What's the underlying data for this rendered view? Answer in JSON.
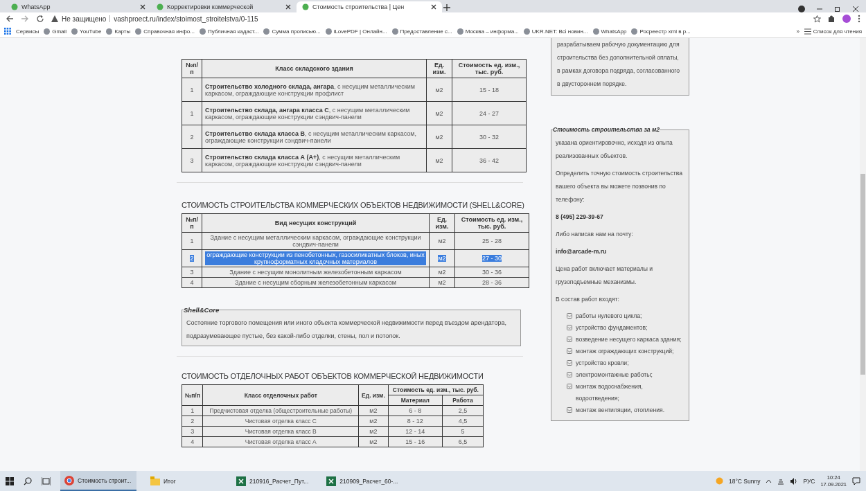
{
  "browser": {
    "tabs": [
      {
        "title": "WhatsApp",
        "selected": false
      },
      {
        "title": "Корректировки коммерческой",
        "selected": false
      },
      {
        "title": "Стоимость строительства | Цен",
        "selected": true
      }
    ],
    "security": "Не защищено",
    "url": "vashproect.ru/index/stoimost_stroitelstva/0-115",
    "bookmarks": [
      "Сервисы",
      "Gmail",
      "YouTube",
      "Карты",
      "Справочная инфо...",
      "Публичная кадаст...",
      "Сумма прописью...",
      "iLovePDF | Онлайн...",
      "Предоставление с...",
      "Москва – информа...",
      "UKR.NET: Всі новин...",
      "WhatsApp",
      "Росреестр xml в р..."
    ],
    "more": "»",
    "reading_list": "Список для чтения"
  },
  "warehouse_table": {
    "columns": [
      "№п/ п",
      "Класс складского здания",
      "Ед. изм.",
      "Стоимость ед. изм., тыс. руб."
    ],
    "rows": [
      [
        "1",
        "**Строительство холодного склада, ангара**, с несущим металлическим каркасом, ограждающие конструкции профлист",
        "м2",
        "15 - 18"
      ],
      [
        "1",
        "**Строительство склада, ангара класса С**, с несущим металлическим каркасом, ограждающие конструкции сэндвич-панели",
        "м2",
        "24 - 27"
      ],
      [
        "2",
        "**Строительство склада класса В**, с несущим металлическим каркасом, ограждающие конструкции сэндвич-панели",
        "м2",
        "30 - 32"
      ],
      [
        "3",
        "**Строительство склада класса А (А+)**, с несущим металлическим каркасом, ограждающие конструкции сэндвич-панели",
        "м2",
        "36 - 42"
      ]
    ]
  },
  "commercial_section": {
    "heading": "СТОИМОСТЬ СТРОИТЕЛЬСТВА КОММЕРЧЕСКИХ ОБЪЕКТОВ НЕДВИЖИМОСТИ (SHELL&CORE)",
    "columns": [
      "№п/ п",
      "Вид несущих конструкций",
      "Ед. изм.",
      "Стоимость ед. изм., тыс. руб."
    ],
    "rows": [
      {
        "cells": [
          "1",
          "Здание с несущим металлическим каркасом, ограждающие конструкции сэндвич-панели",
          "м2",
          "25 - 28"
        ],
        "text_selected": false
      },
      {
        "cells": [
          "2",
          "ограждающие конструкции из пенобетонных, газосиликатных блоков, иных крупноформатных кладочных материалов",
          "м2",
          "27 - 30"
        ],
        "text_selected": true
      },
      {
        "cells": [
          "3",
          "Здание с несущим монолитным железобетонным каркасом",
          "м2",
          "30 - 36"
        ],
        "text_selected": false
      },
      {
        "cells": [
          "4",
          "Здание с несущим сборным железобетонным каркасом",
          "м2",
          "28 - 36"
        ],
        "text_selected": false
      }
    ],
    "note": {
      "title": "Shell&Core",
      "text": "Состояние торгового помещения или иного объекта коммерческой недвижимости перед въездом арендатора, подразумевающее пустые, без какой-либо отделки, стены, пол и потолок."
    }
  },
  "finishing_section": {
    "heading": "СТОИМОСТЬ ОТДЕЛОЧНЫХ РАБОТ ОБЪЕКТОВ КОММЕРЧЕСКОЙ НЕДВИЖИМОСТИ",
    "columns": [
      {
        "label": "№п/п"
      },
      {
        "label": "Класс отделочных работ"
      },
      {
        "label": "Ед. изм."
      },
      {
        "label": "Стоимость ед. изм., тыс. руб.",
        "colspan": 2
      }
    ],
    "subcolumns": [
      "Материал",
      "Работа"
    ],
    "rows": [
      [
        "1",
        "Предчистовая отделка (общестроительные работы)",
        "м2",
        "6 - 8",
        "2,5"
      ],
      [
        "2",
        "Чистовая отделка класс С",
        "м2",
        "8 - 12",
        "4,5"
      ],
      [
        "3",
        "Чистовая отделка класс В",
        "м2",
        "12 - 14",
        "5"
      ],
      [
        "4",
        "Чистовая отделка класс А",
        "м2",
        "15 - 16",
        "6,5"
      ]
    ]
  },
  "sidebar": {
    "top_box": "разрабатываем рабочую документацию для строительства без дополнительной оплаты, в рамках договора подряда, согласованного в двустороннем порядке.",
    "price_box": {
      "title": "Стоимость строительства за м2",
      "paragraphs": [
        {
          "kind": "text",
          "text": "указана ориентировочно, исходя из опыта реализованных объектов."
        },
        {
          "kind": "text",
          "text": "Определить точную стоимость строительства вашего объекта вы можете позвонив по телефону:"
        },
        {
          "kind": "strong",
          "text": "8 (495) 229-39-67"
        },
        {
          "kind": "text",
          "text": "Либо написав нам на почту:"
        },
        {
          "kind": "strong",
          "text": "info@arcade-m.ru"
        },
        {
          "kind": "text",
          "text": "Цена работ включает материалы и грузоподъемные механизмы."
        },
        {
          "kind": "text",
          "text": "В состав работ входят:"
        }
      ],
      "list": [
        "работы нулевого цикла;",
        "устройство фундаментов;",
        "возведение несущего каркаса здания;",
        "монтаж ограждающих конструкций;",
        "устройство кровли;",
        "электромонтажные работы;",
        "монтаж водоснабжения, водоотведения;",
        "монтаж вентиляции, отопления."
      ]
    }
  },
  "taskbar": {
    "apps": [
      {
        "label": "Стоимость строит...",
        "kind": "browser",
        "active": true
      },
      {
        "label": "Итог",
        "kind": "folder",
        "active": false
      },
      {
        "label": "210916_Расчет_Пут...",
        "kind": "sheet",
        "active": false
      },
      {
        "label": "210909_Расчет_60-...",
        "kind": "sheet",
        "active": false
      }
    ],
    "weather": "18°C Sunny",
    "language": "РУС",
    "time": "10:24",
    "date": "17.09.2021"
  }
}
